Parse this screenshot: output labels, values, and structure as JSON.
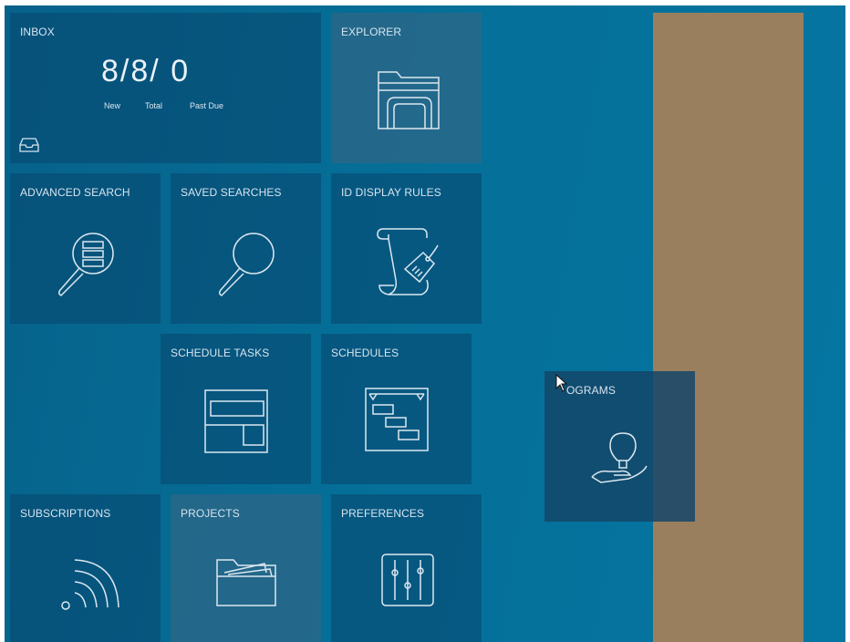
{
  "tiles": {
    "inbox": {
      "title": "INBOX",
      "counts": {
        "new": "8",
        "total": "8",
        "past_due": "0",
        "sep1": "/",
        "sep2": "/"
      },
      "labels": {
        "new": "New",
        "total": "Total",
        "past_due": "Past Due"
      },
      "icon": "inbox-tray-icon"
    },
    "explorer": {
      "title": "EXPLORER",
      "icon": "folder-icon"
    },
    "advanced_search": {
      "title": "ADVANCED SEARCH",
      "icon": "magnifier-list-icon"
    },
    "saved_searches": {
      "title": "SAVED SEARCHES",
      "icon": "magnifier-icon"
    },
    "id_display_rules": {
      "title": "ID DISPLAY RULES",
      "icon": "scroll-tag-icon"
    },
    "schedule_tasks": {
      "title": "SCHEDULE TASKS",
      "icon": "task-blocks-icon"
    },
    "schedules": {
      "title": "SCHEDULES",
      "icon": "gantt-icon"
    },
    "programs": {
      "title": "OGRAMS",
      "icon": "lightbulb-hand-icon"
    },
    "subscriptions": {
      "title": "SUBSCRIPTIONS",
      "icon": "rss-feed-icon"
    },
    "projects": {
      "title": "PROJECTS",
      "icon": "project-folder-icon"
    },
    "preferences": {
      "title": "PREFERENCES",
      "icon": "sliders-icon"
    }
  },
  "colors": {
    "background": "#0570a0",
    "tile": "#0a4a72",
    "stripe": "#9a7f5e"
  }
}
